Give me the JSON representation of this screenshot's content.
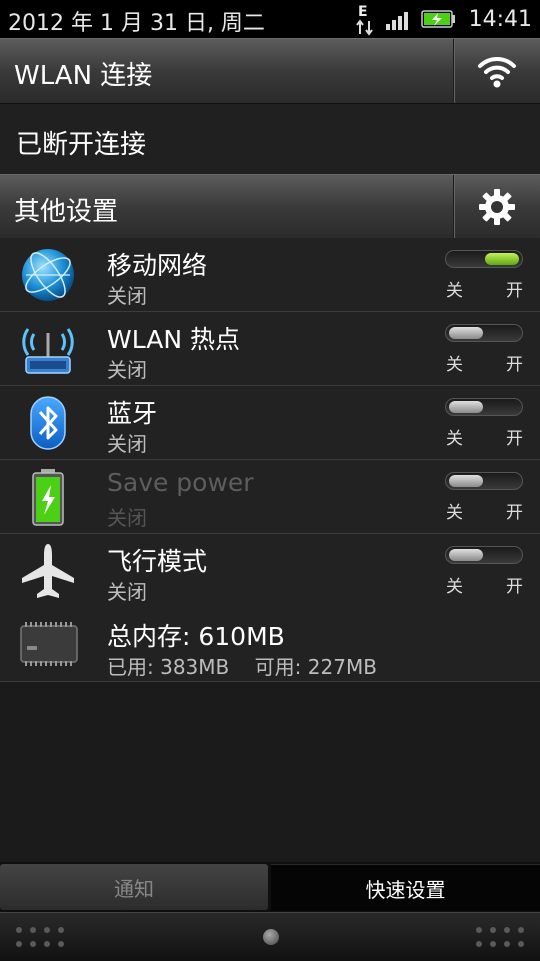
{
  "status_bar": {
    "date": "2012 年 1 月 31 日, 周二",
    "network_type": "E",
    "time": "14:41"
  },
  "wlan_header": {
    "title": "WLAN 连接"
  },
  "wlan_status": "已断开连接",
  "other_settings_header": {
    "title": "其他设置"
  },
  "settings": [
    {
      "title": "移动网络",
      "subtitle": "关闭",
      "icon": "globe-icon",
      "on": true,
      "off_label": "关",
      "on_label": "开"
    },
    {
      "title": "WLAN 热点",
      "subtitle": "关闭",
      "icon": "hotspot-router-icon",
      "on": false,
      "off_label": "关",
      "on_label": "开"
    },
    {
      "title": "蓝牙",
      "subtitle": "关闭",
      "icon": "bluetooth-icon",
      "on": false,
      "off_label": "关",
      "on_label": "开"
    },
    {
      "title": "Save power",
      "subtitle": "关闭",
      "icon": "battery-icon",
      "on": false,
      "off_label": "关",
      "on_label": "开"
    },
    {
      "title": "飞行模式",
      "subtitle": "关闭",
      "icon": "airplane-icon",
      "on": false,
      "off_label": "关",
      "on_label": "开"
    }
  ],
  "memory": {
    "title": "总内存: 610MB",
    "detail": "已用: 383MB    可用: 227MB"
  },
  "tabs": {
    "notifications": "通知",
    "quick_settings": "快速设置"
  },
  "colors": {
    "toggle_on": "#7cc520",
    "battery_green": "#4cd016"
  }
}
